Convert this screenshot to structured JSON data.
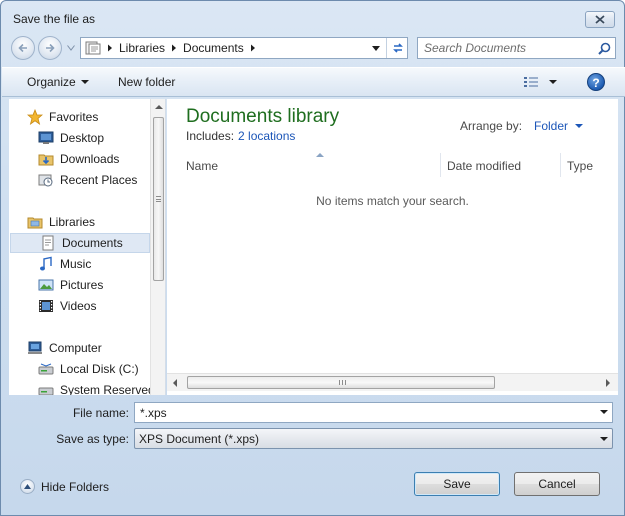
{
  "window": {
    "title": "Save the file as"
  },
  "address": {
    "crumbs": [
      "Libraries",
      "Documents"
    ]
  },
  "search": {
    "placeholder": "Search Documents"
  },
  "toolbar": {
    "organize_label": "Organize",
    "new_folder_label": "New folder",
    "help_label": "?"
  },
  "navpane": {
    "items": [
      {
        "label": "Favorites",
        "icon": "star-icon",
        "group": true
      },
      {
        "label": "Desktop",
        "icon": "desktop-icon"
      },
      {
        "label": "Downloads",
        "icon": "downloads-folder-icon"
      },
      {
        "label": "Recent Places",
        "icon": "recent-places-icon"
      },
      {
        "label": "Libraries",
        "icon": "libraries-icon",
        "group": true
      },
      {
        "label": "Documents",
        "icon": "documents-icon",
        "selected": true
      },
      {
        "label": "Music",
        "icon": "music-icon"
      },
      {
        "label": "Pictures",
        "icon": "pictures-icon"
      },
      {
        "label": "Videos",
        "icon": "videos-icon"
      },
      {
        "label": "Computer",
        "icon": "computer-icon",
        "group": true
      },
      {
        "label": "Local Disk (C:)",
        "icon": "disk-icon"
      },
      {
        "label": "System Reserved",
        "icon": "disk-icon"
      }
    ]
  },
  "content": {
    "library_title": "Documents library",
    "includes_label": "Includes:",
    "includes_link": "2 locations",
    "arrange_label": "Arrange by:",
    "arrange_value": "Folder",
    "columns": [
      "Name",
      "Date modified",
      "Type"
    ],
    "empty_message": "No items match your search."
  },
  "form": {
    "file_name_label": "File name:",
    "file_name_value": "*.xps",
    "save_type_label": "Save as type:",
    "save_type_value": "XPS Document (*.xps)"
  },
  "footer": {
    "hide_folders_label": "Hide Folders",
    "save_label": "Save",
    "cancel_label": "Cancel"
  },
  "colors": {
    "library_title": "#1f6e1f",
    "link": "#1c56b8",
    "selection": "#dfe8f4"
  }
}
